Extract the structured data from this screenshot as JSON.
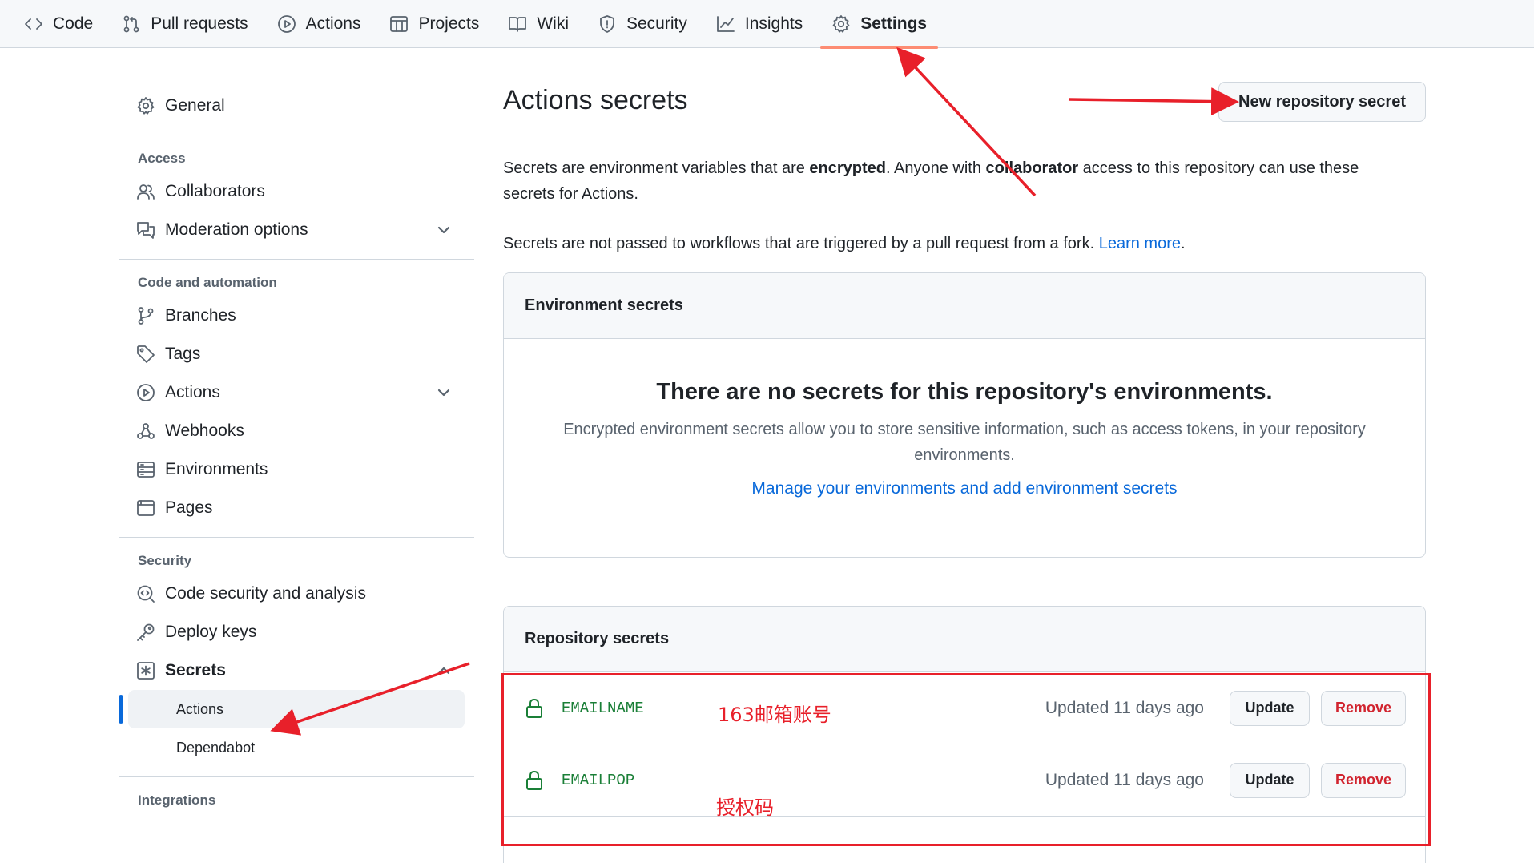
{
  "topnav": {
    "items": [
      {
        "label": "Code",
        "icon": "code-icon"
      },
      {
        "label": "Pull requests",
        "icon": "pull-request-icon"
      },
      {
        "label": "Actions",
        "icon": "play-icon"
      },
      {
        "label": "Projects",
        "icon": "table-icon"
      },
      {
        "label": "Wiki",
        "icon": "book-icon"
      },
      {
        "label": "Security",
        "icon": "shield-icon"
      },
      {
        "label": "Insights",
        "icon": "graph-icon"
      },
      {
        "label": "Settings",
        "icon": "gear-icon",
        "selected": true
      }
    ]
  },
  "sidebar": {
    "general": "General",
    "access_heading": "Access",
    "collaborators": "Collaborators",
    "moderation": "Moderation options",
    "code_heading": "Code and automation",
    "branches": "Branches",
    "tags": "Tags",
    "actions": "Actions",
    "webhooks": "Webhooks",
    "environments": "Environments",
    "pages": "Pages",
    "security_heading": "Security",
    "code_security": "Code security and analysis",
    "deploy_keys": "Deploy keys",
    "secrets": "Secrets",
    "secrets_actions": "Actions",
    "secrets_dependabot": "Dependabot",
    "integrations_heading": "Integrations"
  },
  "main": {
    "title": "Actions secrets",
    "new_secret_button": "New repository secret",
    "desc1_a": "Secrets are environment variables that are ",
    "desc1_b": "encrypted",
    "desc1_c": ". Anyone with ",
    "desc1_d": "collaborator",
    "desc1_e": " access to this repository can use these secrets for Actions.",
    "desc2_a": "Secrets are not passed to workflows that are triggered by a pull request from a fork. ",
    "desc2_link": "Learn more",
    "desc2_end": ".",
    "env_header": "Environment secrets",
    "env_empty_title": "There are no secrets for this repository's environments.",
    "env_empty_desc": "Encrypted environment secrets allow you to store sensitive information, such as access tokens, in your repository environments.",
    "env_link": "Manage your environments and add environment secrets",
    "repo_header": "Repository secrets",
    "secrets": [
      {
        "name": "EMAILNAME",
        "updated": "Updated 11 days ago",
        "update": "Update",
        "remove": "Remove"
      },
      {
        "name": "EMAILPOP",
        "updated": "Updated 11 days ago",
        "update": "Update",
        "remove": "Remove"
      }
    ]
  },
  "annotations": {
    "note1": "163邮箱账号",
    "note2": "授权码",
    "color": "#e8202a"
  },
  "colors": {
    "accent_link": "#0969da",
    "secret_green": "#1a7f37",
    "danger": "#d1242f",
    "tab_underline": "#fd8c73"
  }
}
